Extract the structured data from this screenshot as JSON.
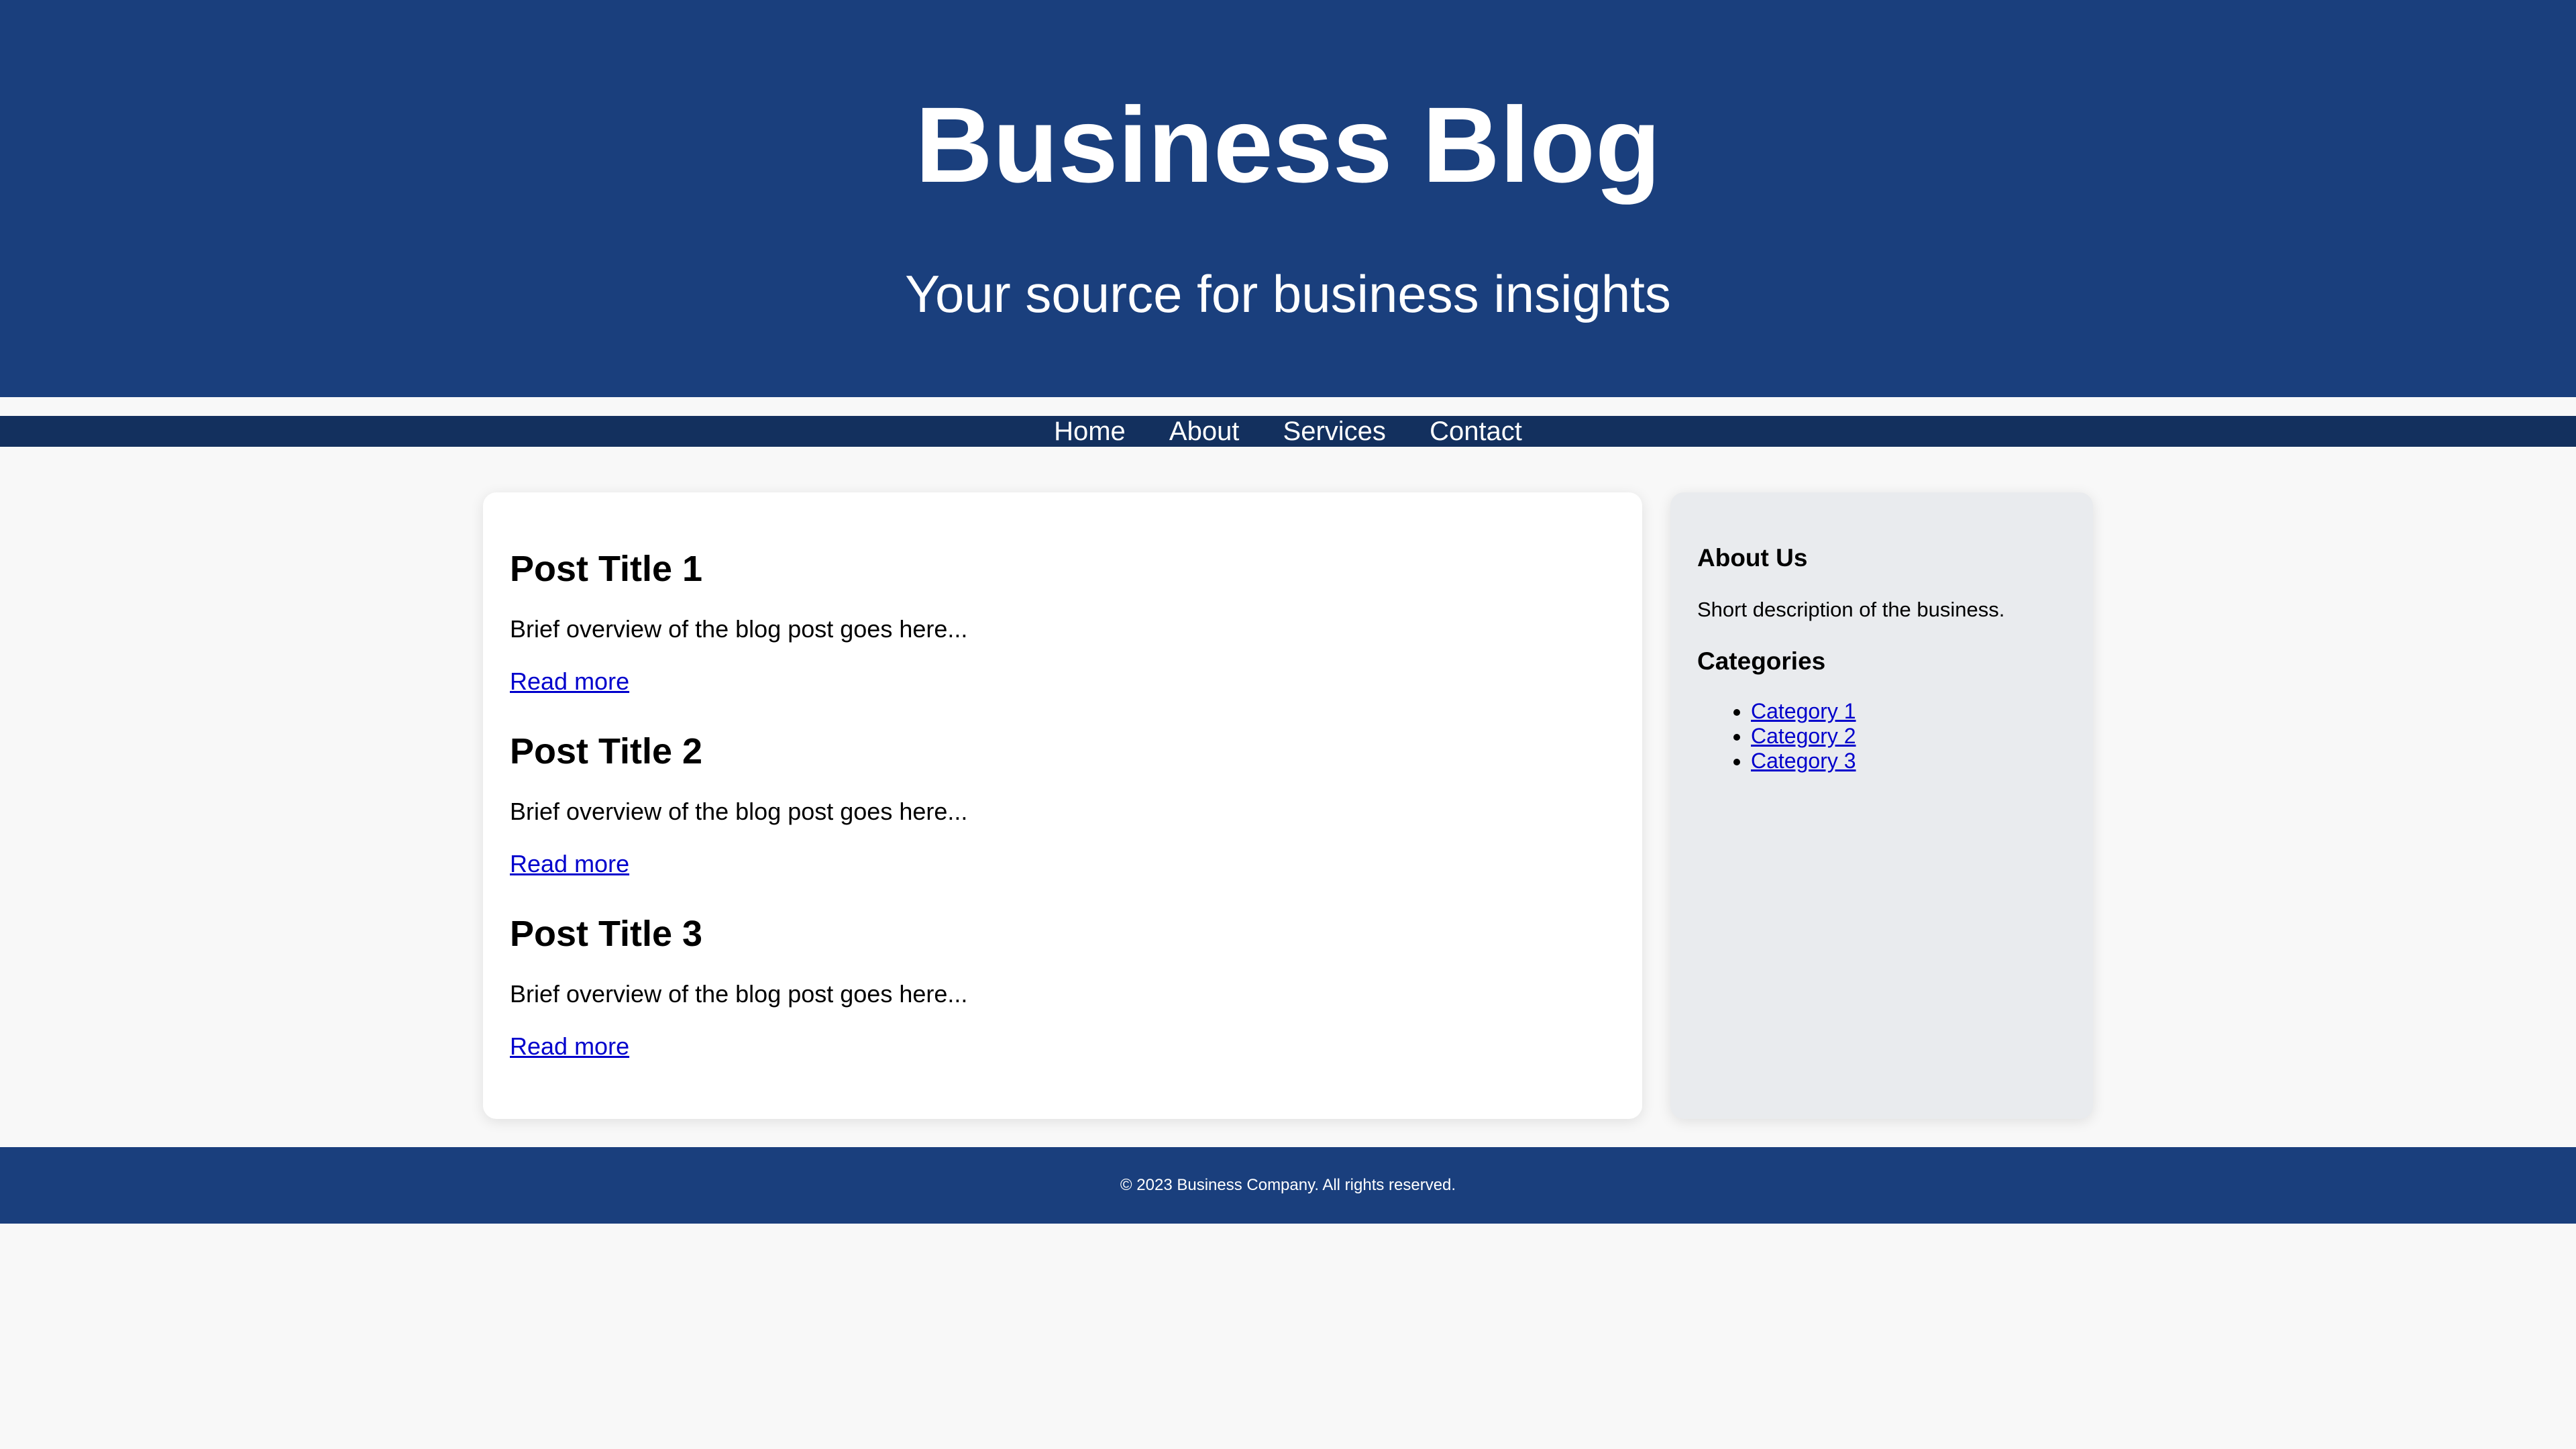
{
  "header": {
    "title": "Business Blog",
    "tagline": "Your source for business insights"
  },
  "nav": {
    "items": [
      {
        "label": "Home"
      },
      {
        "label": "About"
      },
      {
        "label": "Services"
      },
      {
        "label": "Contact"
      }
    ]
  },
  "posts": [
    {
      "title": "Post Title 1",
      "excerpt": "Brief overview of the blog post goes here...",
      "link_label": "Read more"
    },
    {
      "title": "Post Title 2",
      "excerpt": "Brief overview of the blog post goes here...",
      "link_label": "Read more"
    },
    {
      "title": "Post Title 3",
      "excerpt": "Brief overview of the blog post goes here...",
      "link_label": "Read more"
    }
  ],
  "sidebar": {
    "about_heading": "About Us",
    "about_text": "Short description of the business.",
    "categories_heading": "Categories",
    "categories": [
      {
        "label": "Category 1"
      },
      {
        "label": "Category 2"
      },
      {
        "label": "Category 3"
      }
    ]
  },
  "footer": {
    "copyright": "© 2023 Business Company. All rights reserved."
  },
  "colors": {
    "header_bg": "#1a3f7d",
    "nav_bg": "#13305e",
    "page_bg": "#f8f8f8",
    "sidebar_bg": "#e9ebee",
    "link": "#0000cc"
  }
}
